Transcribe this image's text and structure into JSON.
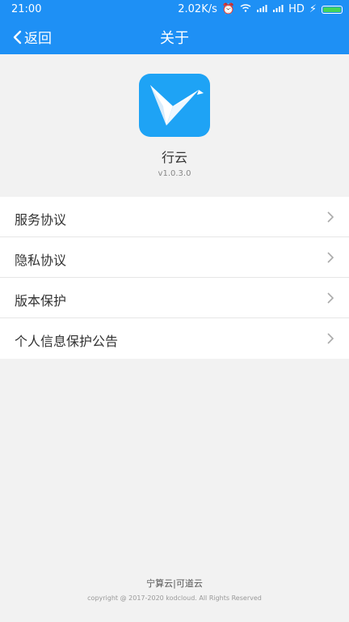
{
  "status_bar": {
    "time": "21:00",
    "speed": "2.02K/s",
    "network": "HD"
  },
  "nav": {
    "back_label": "返回",
    "title": "关于"
  },
  "app": {
    "name": "行云",
    "version": "v1.0.3.0",
    "icon": "paper-crane-logo-icon",
    "brand_color": "#1ea3f5"
  },
  "menu": {
    "items": [
      {
        "label": "服务协议"
      },
      {
        "label": "隐私协议"
      },
      {
        "label": "版本保护"
      },
      {
        "label": "个人信息保护公告"
      }
    ]
  },
  "footer": {
    "brand": "宁算云|可道云",
    "copyright": "copyright @ 2017-2020 kodcloud. All Rights Reserved"
  },
  "theme": {
    "header_color": "#1e90f5",
    "background": "#f2f2f2"
  }
}
